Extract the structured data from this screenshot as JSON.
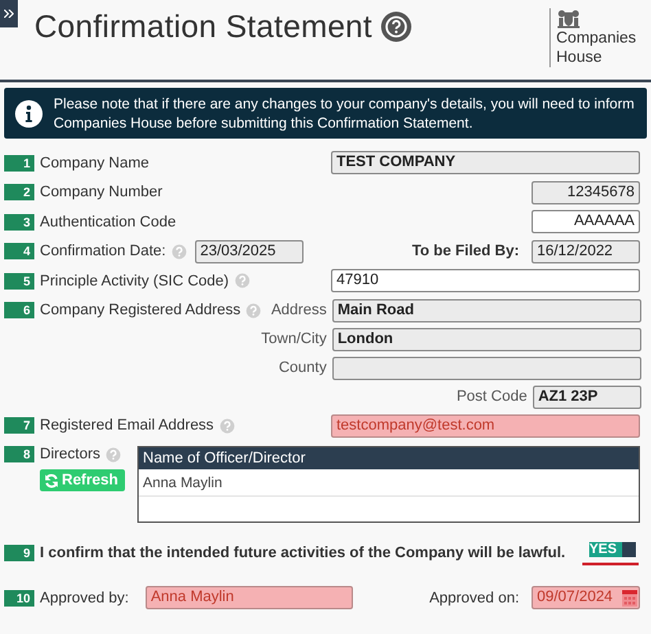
{
  "header": {
    "title": "Confirmation Statement",
    "logo_text": "Companies House"
  },
  "notice": "Please note that if there are any changes to your company's details, you will need to inform Companies House before submitting this Confirmation Statement.",
  "items": [
    {
      "number": "1",
      "kind": "wide",
      "label": "Company Name",
      "help": false,
      "field": {
        "value": "TEST COMPANY",
        "readonly": true,
        "invalid": false
      }
    },
    {
      "number": "2",
      "kind": "short",
      "label": "Company Number",
      "help": false,
      "field": {
        "value": "12345678",
        "readonly": true,
        "invalid": false
      }
    },
    {
      "number": "3",
      "kind": "short",
      "label": "Authentication Code",
      "help": false,
      "field": {
        "value": "AAAAAA",
        "readonly": false,
        "invalid": false
      }
    },
    {
      "number": "4",
      "kind": "dates",
      "label": "Confirmation Date:",
      "help": true,
      "field": {
        "value": "23/03/2025",
        "readonly": true,
        "invalid": false
      },
      "second_label": "To be Filed By:",
      "second_field": {
        "value": "16/12/2022",
        "readonly": true,
        "invalid": false
      }
    },
    {
      "number": "5",
      "kind": "wide",
      "label": "Principle Activity (SIC Code)",
      "help": true,
      "field": {
        "value": "47910",
        "readonly": false,
        "invalid": false
      }
    },
    {
      "number": "6",
      "kind": "address",
      "label": "Company Registered Address",
      "help": true,
      "lines": [
        {
          "label": "Address",
          "value": "Main Road",
          "readonly": true
        },
        {
          "label": "Town/City",
          "value": "London",
          "readonly": true
        },
        {
          "label": "County",
          "readonly": true
        },
        {
          "label": "Post Code",
          "value": "AZ1 23P",
          "readonly": true,
          "short": true
        }
      ]
    },
    {
      "number": "7",
      "kind": "wide",
      "label": "Registered Email Address",
      "help": true,
      "field": {
        "value": "testcompany@test.com",
        "readonly": false,
        "invalid": true
      }
    },
    {
      "number": "8",
      "kind": "directors",
      "label": "Directors",
      "help": true,
      "button": "Refresh",
      "column": "Name of Officer/Director",
      "rows": [
        "Anna Maylin"
      ]
    },
    {
      "number": "9",
      "kind": "confirm",
      "label": "I confirm that the intended future activities of the Company will be lawful.",
      "toggle": {
        "label": "YES",
        "on": true,
        "invalid": true
      }
    },
    {
      "number": "10",
      "kind": "approval",
      "label": "Approved by:",
      "field": {
        "value": "Anna Maylin",
        "readonly": false,
        "invalid": true
      },
      "second_label": "Approved on:",
      "second_field": {
        "value": "09/07/2024",
        "readonly": false,
        "invalid": true
      }
    }
  ]
}
